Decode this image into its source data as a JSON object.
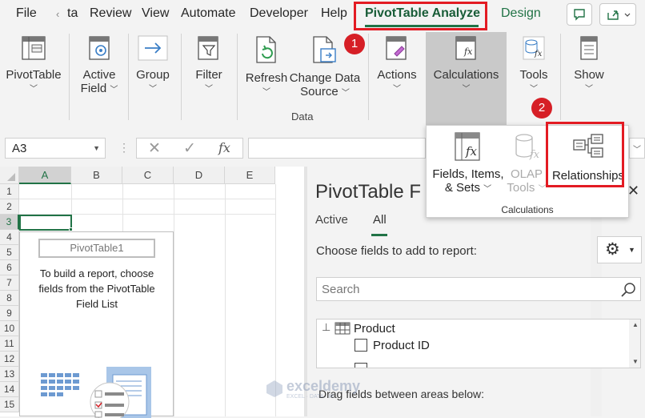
{
  "tabs": {
    "file": "File",
    "ta": "ta",
    "review": "Review",
    "view": "View",
    "automate": "Automate",
    "developer": "Developer",
    "help": "Help",
    "pivot_analyze": "PivotTable Analyze",
    "design": "Design"
  },
  "badges": {
    "one": "1",
    "two": "2"
  },
  "ribbon": {
    "pivottable": "PivotTable",
    "active_field_1": "Active",
    "active_field_2": "Field",
    "group": "Group",
    "filter": "Filter",
    "refresh": "Refresh",
    "change_data_1": "Change Data",
    "change_data_2": "Source",
    "data_group": "Data",
    "actions": "Actions",
    "calculations": "Calculations",
    "tools": "Tools",
    "show": "Show"
  },
  "formula_bar": {
    "name_box": "A3",
    "fx": "fx"
  },
  "grid": {
    "columns": [
      "A",
      "B",
      "C",
      "D",
      "E"
    ],
    "rows": [
      "1",
      "2",
      "3",
      "4",
      "5",
      "6",
      "7",
      "8",
      "9",
      "10",
      "11",
      "12",
      "13",
      "14",
      "15"
    ],
    "pivot_title": "PivotTable1",
    "instructions": "To build a report, choose fields from the PivotTable Field List"
  },
  "calc_menu": {
    "fields_items_1": "Fields, Items,",
    "fields_items_2": "& Sets",
    "olap_1": "OLAP",
    "olap_2": "Tools",
    "relationships": "Relationships",
    "group_label": "Calculations"
  },
  "pane": {
    "title": "PivotTable F",
    "tab_active": "Active",
    "tab_all": "All",
    "choose_fields": "Choose fields to add to report:",
    "search_placeholder": "Search",
    "product": "Product",
    "product_id": "Product ID",
    "drag_hint": "Drag fields between areas below:"
  },
  "watermark": {
    "name": "exceldemy",
    "tagline": "EXCEL · DATA · BI"
  },
  "colors": {
    "accent": "#217346",
    "highlight_red": "#e31b23"
  }
}
